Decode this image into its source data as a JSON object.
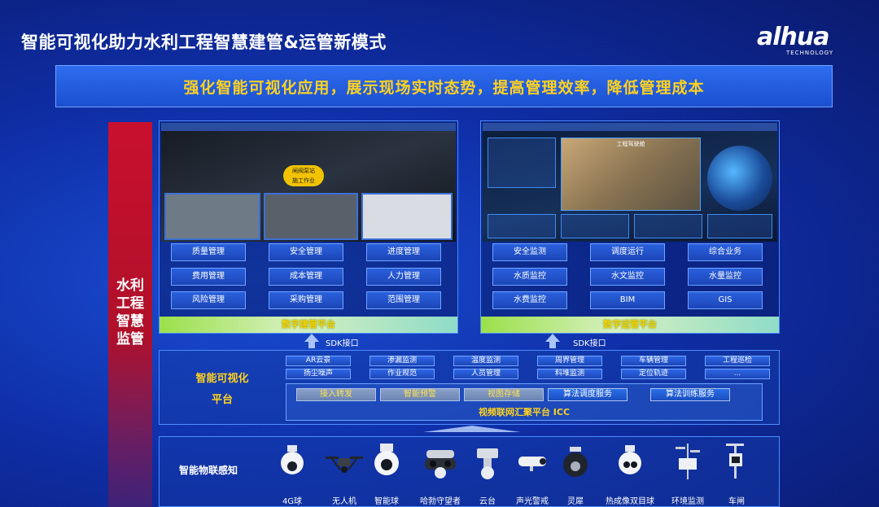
{
  "title": "智能可视化助力水利工程智慧建管&运管新模式",
  "logo": {
    "text_main": "alhua",
    "text_sub": "TECHNOLOGY"
  },
  "slogan": "强化智能可视化应用，展示现场实时态势，提高管理效率，降低管理成本",
  "side_label": [
    "水利",
    "工程",
    "智慧",
    "监管"
  ],
  "left_panel": {
    "screenshot_badge": "闸阀泵站\n施工作业",
    "modules": [
      "质量管理",
      "安全管理",
      "进度管理",
      "费用管理",
      "成本管理",
      "人力管理",
      "风险管理",
      "采购管理",
      "范围管理"
    ],
    "platform": "数字建管平台"
  },
  "right_panel": {
    "screenshot_title": "工程驾驶舱",
    "modules": [
      "安全监测",
      "调度运行",
      "综合业务",
      "水质监控",
      "水文监控",
      "水量监控",
      "水费监控",
      "BIM",
      "GIS"
    ],
    "platform": "数字运管平台"
  },
  "sdk_label_left": "SDK接口",
  "sdk_label_right": "SDK接口",
  "viz_platform": {
    "label_line1": "智能可视化",
    "label_line2": "平台",
    "apps_row1": [
      "AR云景",
      "渗漏监测",
      "温度监测",
      "周界管理",
      "车辆管理",
      "工程巡检"
    ],
    "apps_row2": [
      "扬尘噪声",
      "作业规范",
      "人员管理",
      "料堆监测",
      "定位轨迹",
      "..."
    ],
    "services": [
      "接入转发",
      "智能预警",
      "视图存储",
      "算法调度服务",
      "算法训练服务"
    ],
    "icc": "视频联网汇聚平台 ICC"
  },
  "iot": {
    "label": "智能物联感知",
    "devices": [
      "4G球",
      "无人机",
      "智能球",
      "哈勃守望者",
      "云台",
      "声光警戒",
      "灵犀",
      "热成像双目球",
      "环境监测",
      "车闸"
    ]
  },
  "colors": {
    "accent_yellow": "#ffd21f",
    "brand_red": "#e60012",
    "panel_border": "#4d8cff"
  }
}
